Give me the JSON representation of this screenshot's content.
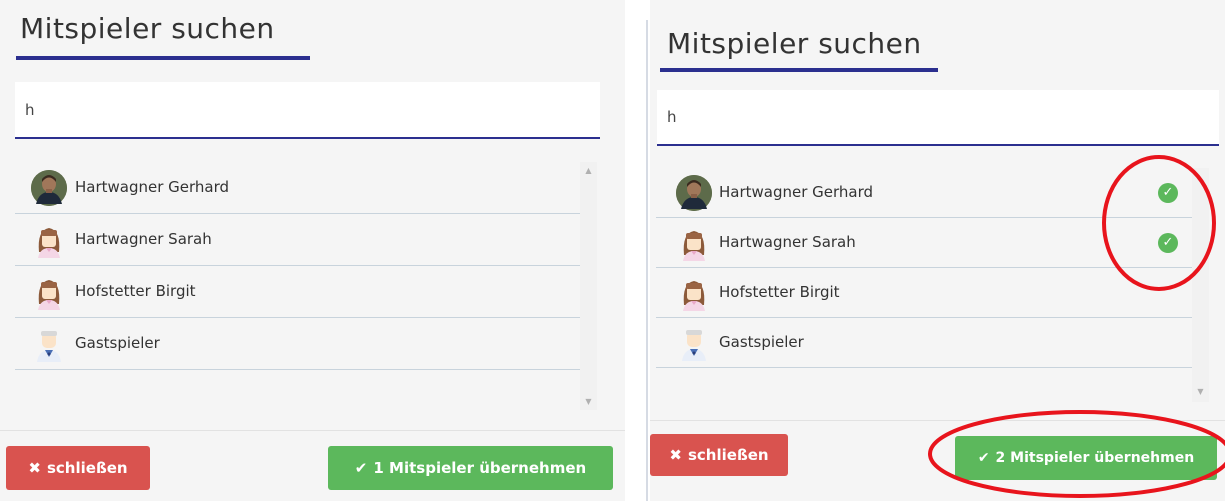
{
  "colors": {
    "accent": "#2b2f8f",
    "success": "#5cb85c",
    "danger": "#d9534f",
    "annotation": "#e8141c"
  },
  "left": {
    "title": "Mitspieler suchen",
    "search_value": "h",
    "players": [
      {
        "name": "Hartwagner Gerhard",
        "avatar": "photo-avatar-icon",
        "selected": false
      },
      {
        "name": "Hartwagner Sarah",
        "avatar": "female-avatar-icon",
        "selected": false
      },
      {
        "name": "Hofstetter Birgit",
        "avatar": "female-avatar-icon",
        "selected": false
      },
      {
        "name": "Gastspieler",
        "avatar": "guest-avatar-icon",
        "selected": false
      }
    ],
    "close_label": "schließen",
    "close_icon": "x-icon",
    "confirm_label": "1 Mitspieler übernehmen",
    "confirm_icon": "check-icon"
  },
  "right": {
    "title": "Mitspieler suchen",
    "search_value": "h",
    "players": [
      {
        "name": "Hartwagner Gerhard",
        "avatar": "photo-avatar-icon",
        "selected": true
      },
      {
        "name": "Hartwagner Sarah",
        "avatar": "female-avatar-icon",
        "selected": true
      },
      {
        "name": "Hofstetter Birgit",
        "avatar": "female-avatar-icon",
        "selected": false
      },
      {
        "name": "Gastspieler",
        "avatar": "guest-avatar-icon",
        "selected": false
      }
    ],
    "close_label": "schließen",
    "close_icon": "x-icon",
    "confirm_label": "2 Mitspieler übernehmen",
    "confirm_icon": "check-icon",
    "annotations": [
      "red-circle-around-checkmarks",
      "red-circle-around-confirm-button"
    ]
  }
}
